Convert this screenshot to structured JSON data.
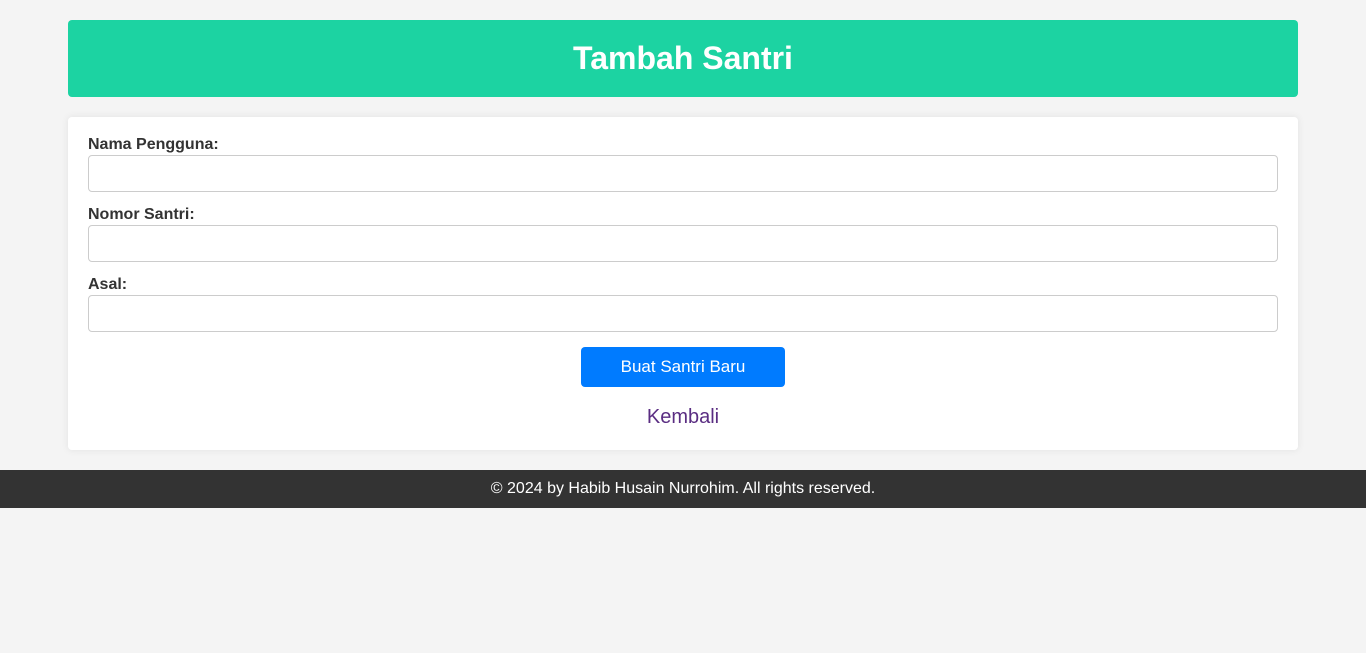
{
  "header": {
    "title": "Tambah Santri"
  },
  "form": {
    "fields": [
      {
        "label": "Nama Pengguna:",
        "value": "",
        "placeholder": ""
      },
      {
        "label": "Nomor Santri:",
        "value": "",
        "placeholder": ""
      },
      {
        "label": "Asal:",
        "value": "",
        "placeholder": ""
      }
    ],
    "submit_label": "Buat Santri Baru",
    "back_label": "Kembali"
  },
  "footer": {
    "text": "© 2024 by Habib Husain Nurrohim. All rights reserved."
  },
  "colors": {
    "header_bg": "#1cd3a2",
    "button_bg": "#007bff",
    "link_color": "#5a2d82",
    "footer_bg": "#333333",
    "page_bg": "#f4f4f4"
  }
}
